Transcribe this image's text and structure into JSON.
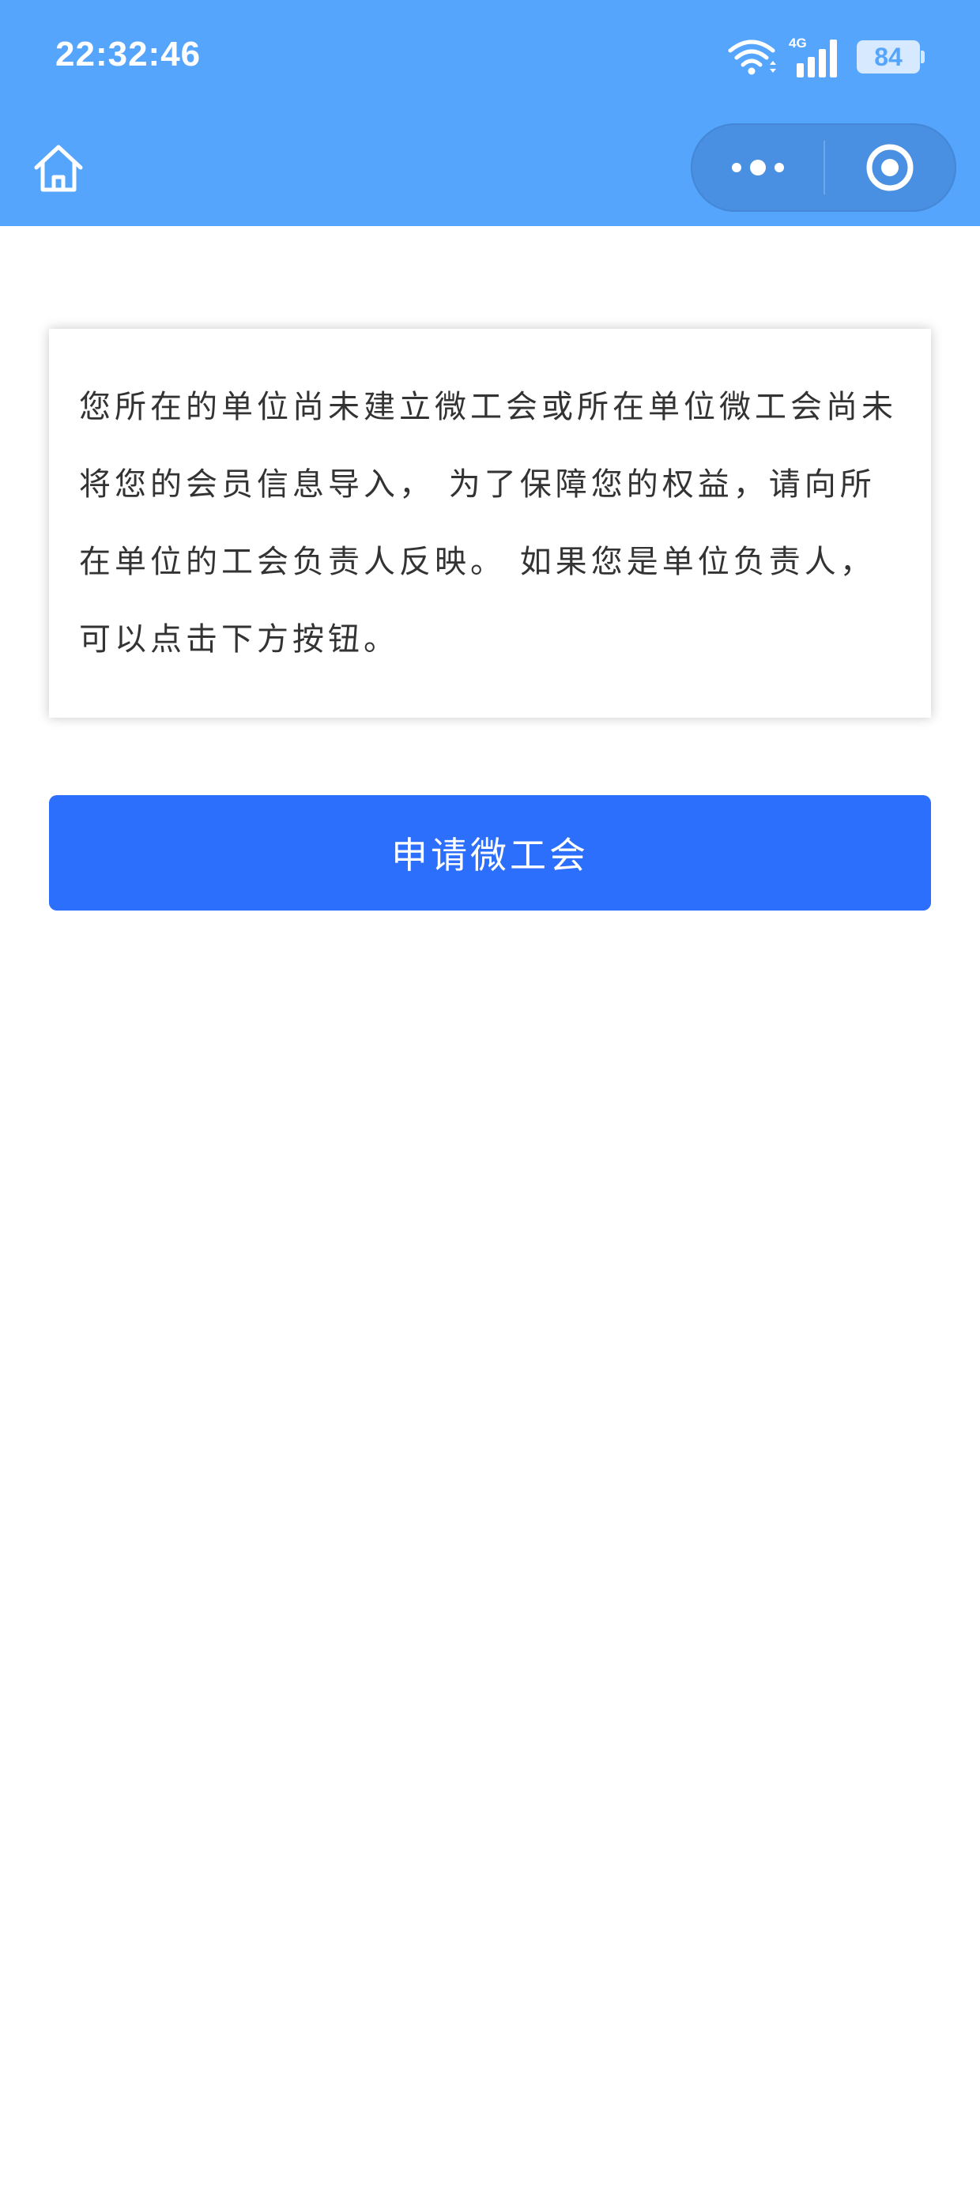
{
  "status_bar": {
    "time": "22:32:46",
    "network": "4G",
    "battery": "84",
    "icons": [
      "wifi-icon",
      "signal-icon",
      "battery-icon"
    ]
  },
  "nav_bar": {
    "home_icon": "home-icon",
    "more_icon": "more-dots-icon",
    "close_icon": "target-circle-icon"
  },
  "notice": {
    "text": "您所在的单位尚未建立微工会或所在单位微工会尚未将您的会员信息导入， 为了保障您的权益，请向所在单位的工会负责人反映。 如果您是单位负责人，可以点击下方按钮。"
  },
  "apply_button": {
    "label": "申请微工会"
  },
  "colors": {
    "header_bg": "#55a5fc",
    "capsule_bg": "#4a90e2",
    "button_bg": "#2d6ffd",
    "text": "#333333"
  }
}
